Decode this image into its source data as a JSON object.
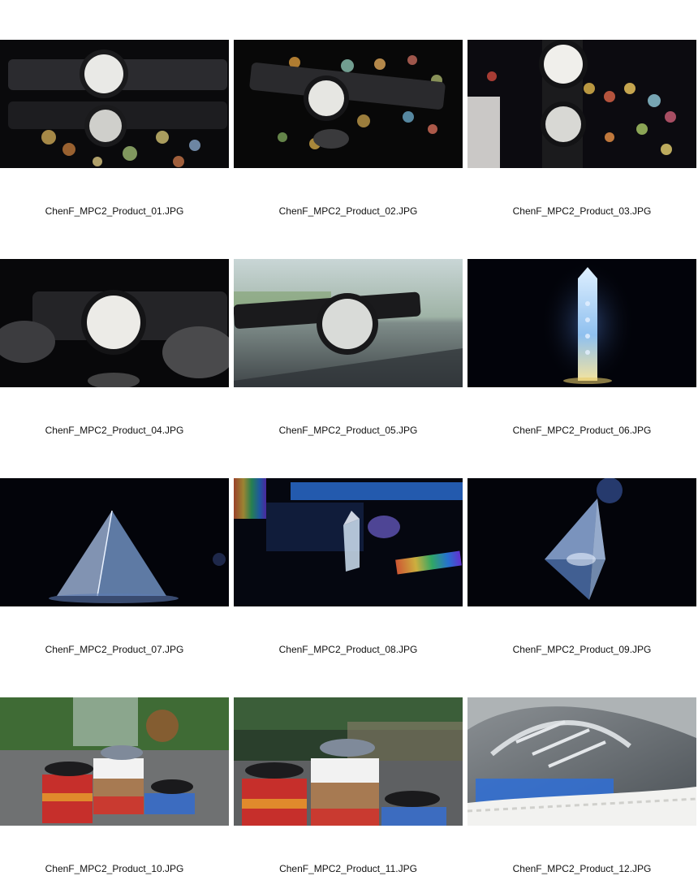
{
  "contact_sheet": {
    "items": [
      {
        "filename": "ChenF_MPC2_Product_01.JPG",
        "subject": "wristwatch-with-reflection-on-bokeh"
      },
      {
        "filename": "ChenF_MPC2_Product_02.JPG",
        "subject": "wristwatch-on-bokeh"
      },
      {
        "filename": "ChenF_MPC2_Product_03.JPG",
        "subject": "wristwatch-upright-reflection"
      },
      {
        "filename": "ChenF_MPC2_Product_04.JPG",
        "subject": "wristwatch-between-stones"
      },
      {
        "filename": "ChenF_MPC2_Product_05.JPG",
        "subject": "wristwatch-on-windowsill"
      },
      {
        "filename": "ChenF_MPC2_Product_06.JPG",
        "subject": "glowing-crystal-point"
      },
      {
        "filename": "ChenF_MPC2_Product_07.JPG",
        "subject": "glass-pyramid"
      },
      {
        "filename": "ChenF_MPC2_Product_08.JPG",
        "subject": "prism-with-rainbow-light"
      },
      {
        "filename": "ChenF_MPC2_Product_09.JPG",
        "subject": "glass-tetrahedron"
      },
      {
        "filename": "ChenF_MPC2_Product_10.JPG",
        "subject": "sneakers-on-shoeboxes"
      },
      {
        "filename": "ChenF_MPC2_Product_11.JPG",
        "subject": "sneakers-on-shoeboxes-wide"
      },
      {
        "filename": "ChenF_MPC2_Product_12.JPG",
        "subject": "sneaker-closeup"
      }
    ]
  },
  "colors": {
    "background": "#ffffff",
    "caption_text": "#111111",
    "thumb_dark": "#05060a"
  }
}
